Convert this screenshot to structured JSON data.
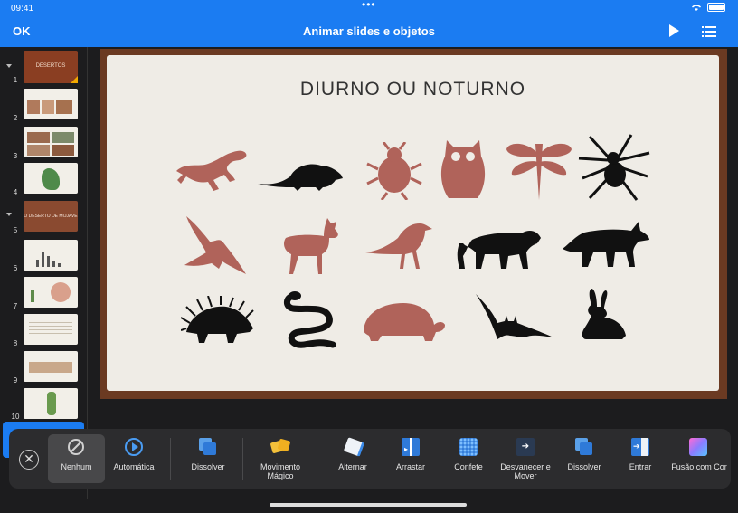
{
  "status": {
    "time": "09:41",
    "dots": "•••"
  },
  "nav": {
    "ok": "OK",
    "title": "Animar slides e objetos",
    "play_icon": "play-icon",
    "list_icon": "list-icon"
  },
  "sidebar": {
    "slides": [
      {
        "num": "1",
        "text": "DESERTOS"
      },
      {
        "num": "2"
      },
      {
        "num": "3"
      },
      {
        "num": "4"
      },
      {
        "num": "5",
        "text": "O DESERTO DE MOJAVE"
      },
      {
        "num": "6"
      },
      {
        "num": "7"
      },
      {
        "num": "8"
      },
      {
        "num": "9"
      },
      {
        "num": "10"
      }
    ]
  },
  "slide": {
    "title": "DIURNO OU NOTURNO",
    "animals": [
      "lizard",
      "rat",
      "beetle",
      "owl",
      "dragonfly",
      "spider",
      "hawk",
      "deer",
      "bird",
      "jaguar",
      "wolf",
      "porcupine",
      "snake",
      "tortoise",
      "bat",
      "rabbit"
    ]
  },
  "effects": {
    "close": "✕",
    "items": [
      {
        "label": "Nenhum"
      },
      {
        "label": "Automática"
      },
      {
        "label": "Dissolver"
      },
      {
        "label": "Movimento Mágico"
      },
      {
        "label": "Alternar"
      },
      {
        "label": "Arrastar"
      },
      {
        "label": "Confete"
      },
      {
        "label": "Desvanecer e Mover"
      },
      {
        "label": "Dissolver"
      },
      {
        "label": "Entrar"
      },
      {
        "label": "Fusão com Cor"
      }
    ]
  },
  "colors": {
    "accent": "#1b7cf2",
    "red_animal": "#b0635a",
    "black_animal": "#111111",
    "stage_frame": "#6b3a22"
  }
}
